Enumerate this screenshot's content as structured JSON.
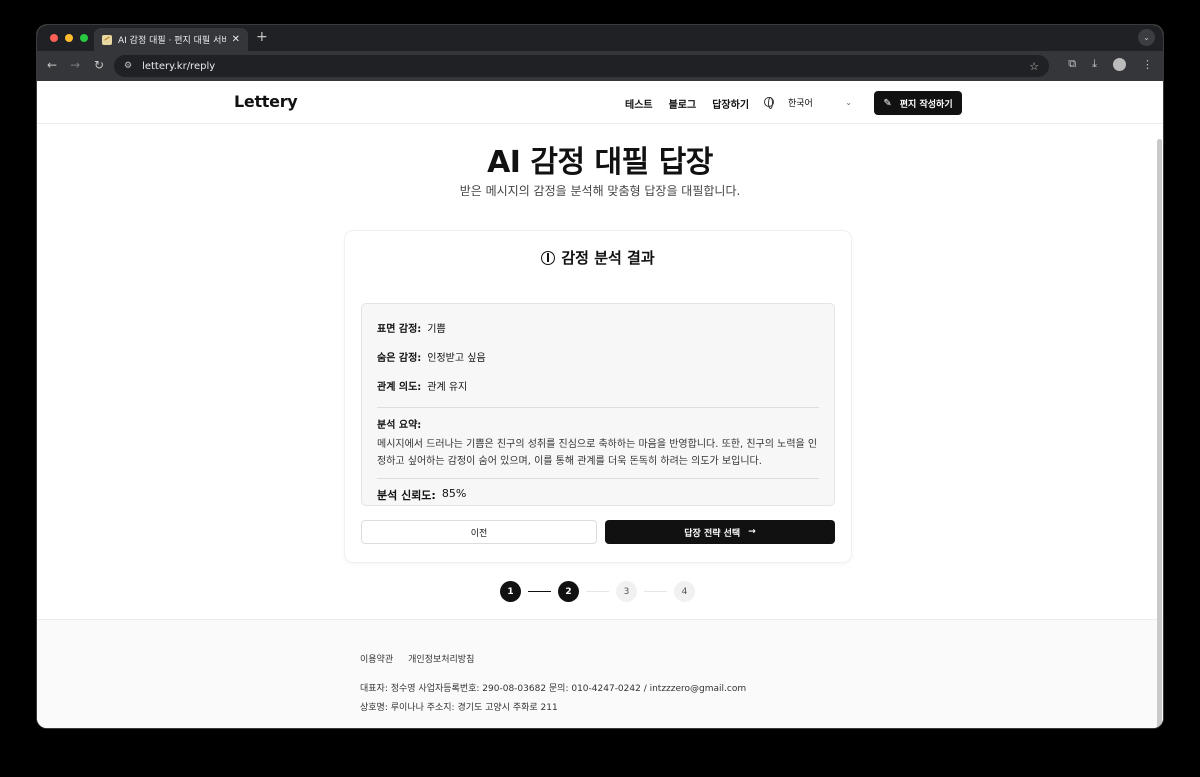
{
  "browser": {
    "tab_title": "AI 감정 대필 · 편지 대필 서비스 - L",
    "tab_close": "✕",
    "new_tab": "+",
    "url": "lettery.kr/reply"
  },
  "header": {
    "logo": "Lettery",
    "nav": [
      "테스트",
      "블로그",
      "답장하기"
    ],
    "language": "한국어",
    "write_button": "편지 작성하기"
  },
  "hero": {
    "title": "AI 감정 대필 답장",
    "subtitle": "받은 메시지의 감정을 분석해 맞춤형 답장을 대필합니다."
  },
  "analysis": {
    "heading": "감정 분석 결과",
    "surface_label": "표면 감정:",
    "surface_value": "기쁨",
    "hidden_label": "숨은 감정:",
    "hidden_value": "인정받고 싶음",
    "intent_label": "관계 의도:",
    "intent_value": "관계 유지",
    "summary_label": "분석 요약:",
    "summary_text": "메시지에서 드러나는 기쁨은 친구의 성취를 진심으로 축하하는 마음을 반영합니다. 또한, 친구의 노력을 인정하고 싶어하는 감정이 숨어 있으며, 이를 통해 관계를 더욱 돈독히 하려는 의도가 보입니다.",
    "confidence_label": "분석 신뢰도:",
    "confidence_value": "85%",
    "prev_button": "이전",
    "next_button": "답장 전략 선택",
    "next_arrow": "→"
  },
  "steps": {
    "labels": [
      "1",
      "2",
      "3",
      "4"
    ],
    "current": 2
  },
  "footer": {
    "links": [
      "이용약관",
      "개인정보처리방침"
    ],
    "line1": "대표자: 정수영  사업자등록번호: 290-08-03682  문의: 010-4247-0242 / intzzzero@gmail.com",
    "line2": "상호명: 루이나나  주소지: 경기도 고양시 주화로 211"
  }
}
